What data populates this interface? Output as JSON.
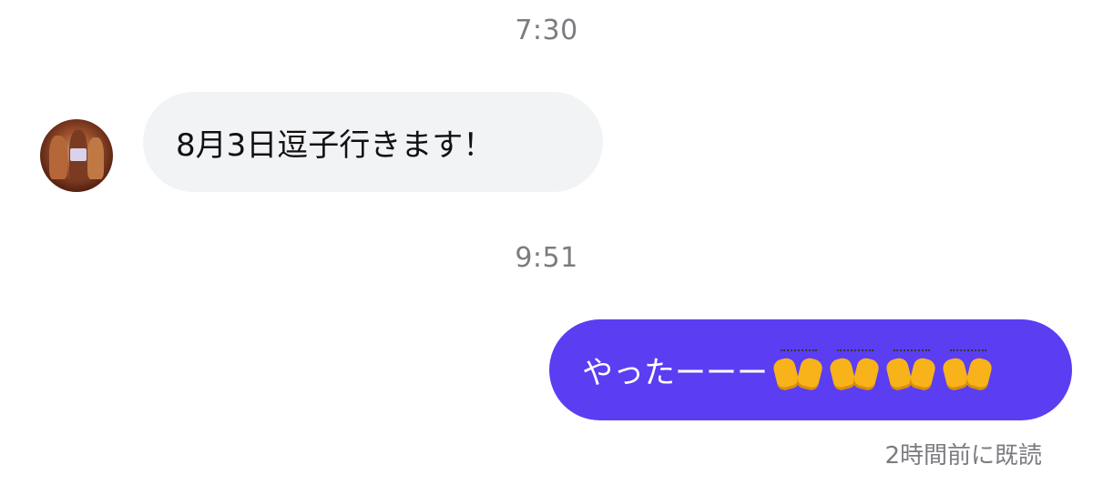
{
  "messages": {
    "first": {
      "time": "7:30",
      "text": "8月3日逗子行きます！"
    },
    "second": {
      "time": "9:51",
      "text": "やったーーー",
      "emoji": [
        "raising-hands-icon",
        "raising-hands-icon",
        "raising-hands-icon",
        "raising-hands-icon"
      ],
      "status": "2時間前に既読"
    }
  },
  "colors": {
    "incoming_bubble": "#f2f3f5",
    "outgoing_bubble": "#5b3df2",
    "timestamp": "#7b7c80"
  }
}
